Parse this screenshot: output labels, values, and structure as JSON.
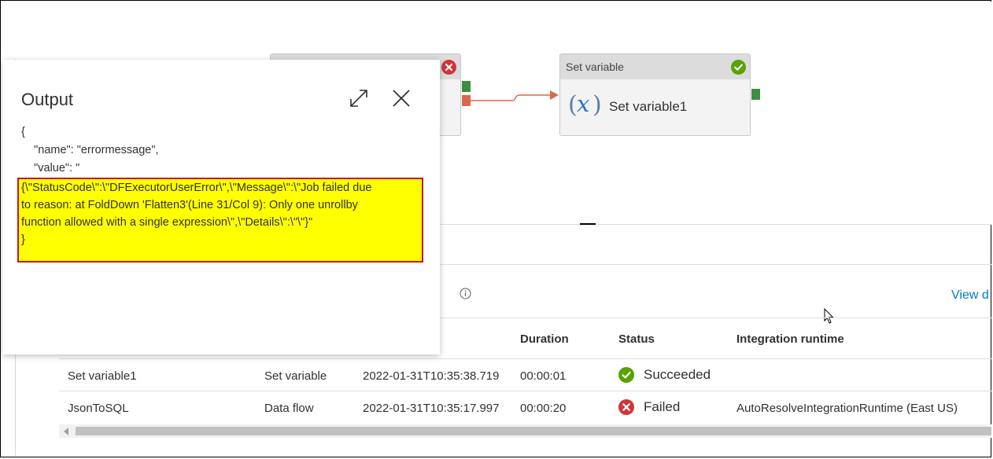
{
  "pipeline": {
    "activities": [
      {
        "name": "JsonToSQL",
        "type": "Data flow",
        "status": "failed"
      },
      {
        "header": "Set variable",
        "name": "Set variable1",
        "status": "succeeded",
        "icon": "variable-x-icon"
      }
    ],
    "connector_color": "#d9694d",
    "success_color": "#57a300",
    "fail_color": "#d13438",
    "port_success_color": "#3e8e41",
    "port_fail_color": "#d9694d"
  },
  "output": {
    "title": "Output",
    "json_lines": [
      "{",
      "    \"name\": \"errormessage\",",
      "    \"value\": \""
    ],
    "highlight_lines": [
      "{\\\"StatusCode\\\":\\\"DFExecutorUserError\\\",\\\"Message\\\":\\\"Job failed due",
      "to reason: at FoldDown 'Flatten3'(Line 31/Col 9): Only one unrollby",
      "function allowed with a single expression\\\",\\\"Details\\\":\\\"\\\"}\"",
      "}"
    ],
    "highlight_color": "#ffff00",
    "highlight_border": "#c5161d"
  },
  "activity_runs": {
    "view_link": "View d",
    "columns": [
      "Duration",
      "Status",
      "Integration runtime"
    ],
    "rows": [
      {
        "name": "Set variable1",
        "type": "Set variable",
        "run_start": "2022-01-31T10:35:38.719",
        "duration": "00:00:01",
        "status": "Succeeded",
        "runtime": ""
      },
      {
        "name": "JsonToSQL",
        "type": "Data flow",
        "run_start": "2022-01-31T10:35:17.997",
        "duration": "00:00:20",
        "status": "Failed",
        "runtime": "AutoResolveIntegrationRuntime (East US)"
      }
    ]
  }
}
